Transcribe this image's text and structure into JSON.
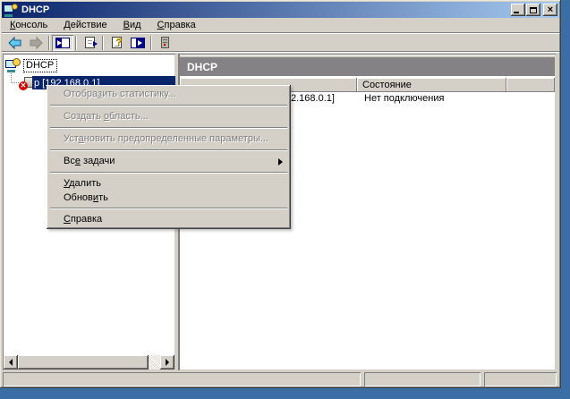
{
  "window": {
    "title": "DHCP"
  },
  "title_bar": {
    "minimize": "",
    "maximize": "",
    "close": "×"
  },
  "menu_bar": {
    "items": [
      {
        "u": "К",
        "rest": "онсоль"
      },
      {
        "u": "Д",
        "rest": "ействие"
      },
      {
        "u": "В",
        "rest": "ид"
      },
      {
        "u": "С",
        "rest": "правка"
      }
    ]
  },
  "toolbar": {
    "icons": [
      "back",
      "forward",
      "show-hide-console-tree",
      "export-list",
      "help",
      "show-taskpad",
      "server"
    ]
  },
  "tree": {
    "root_label": "DHCP",
    "server_label": "p [192.168.0.1]"
  },
  "right_pane": {
    "banner_title": "DHCP",
    "columns": [
      {
        "label": ""
      },
      {
        "label": "Состояние"
      },
      {
        "label": ""
      }
    ],
    "rows": [
      {
        "server_fragment": "2.168.0.1]",
        "status": "Нет подключения"
      }
    ]
  },
  "context_menu": {
    "items": [
      {
        "pre": "Отобра",
        "u": "з",
        "post": "ить статистику...",
        "disabled": true
      },
      {
        "separator": true
      },
      {
        "pre": "Создать ",
        "u": "о",
        "post": "бласть...",
        "disabled": true
      },
      {
        "separator": true
      },
      {
        "pre": "Уст",
        "u": "а",
        "post": "новить предопределенные параметры...",
        "disabled": true
      },
      {
        "separator": true
      },
      {
        "pre": "Вс",
        "u": "е",
        "post": " задачи",
        "submenu": true
      },
      {
        "separator": true
      },
      {
        "pre": "",
        "u": "У",
        "post": "далить"
      },
      {
        "pre": "Обнов",
        "u": "и",
        "post": "ть"
      },
      {
        "separator": true
      },
      {
        "pre": "",
        "u": "С",
        "post": "правка"
      }
    ]
  },
  "colors": {
    "desktop": "#3A6EA5",
    "titlebar_gradient_start": "#0A246A",
    "titlebar_gradient_end": "#A6CAF0",
    "window_face": "#D4D0C8",
    "selection": "#0A246A",
    "result_banner": "#848284",
    "disabled_text": "#808080",
    "status_text": "#000000"
  }
}
